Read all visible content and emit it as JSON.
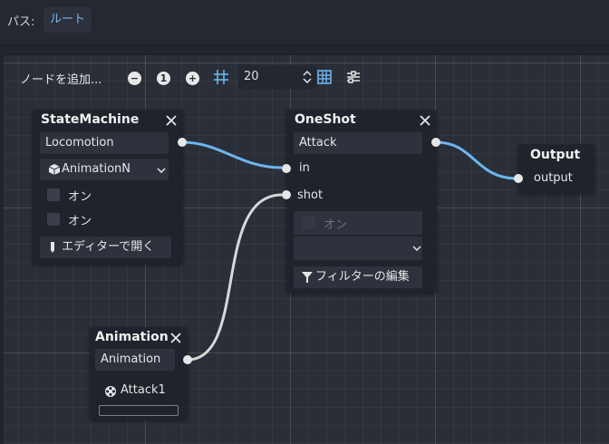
{
  "path": {
    "label": "パス:",
    "root": "ルート"
  },
  "toolbar": {
    "add_node": "ノードを追加...",
    "zoom_out": "−",
    "zoom_reset": "1",
    "zoom_in": "+",
    "snap_value": "20",
    "icons": [
      "zoom-out-icon",
      "zoom-reset-icon",
      "zoom-in-icon",
      "snap-grid-icon",
      "spin-arrows-icon",
      "grid-toggle-icon",
      "minimap-icon"
    ]
  },
  "nodes": {
    "statemachine": {
      "title": "StateMachine",
      "port_label": "Locomotion",
      "animation_select": "AnimationN",
      "toggle1": "オン",
      "toggle2": "オン",
      "open_editor": "エディターで開く"
    },
    "oneshot": {
      "title": "OneShot",
      "out_label": "Attack",
      "in_label": "in",
      "shot_label": "shot",
      "toggle": "オン",
      "filter_button": "フィルターの編集"
    },
    "output": {
      "title": "Output",
      "in_label": "output"
    },
    "animation": {
      "title": "Animation",
      "out_label": "Animation",
      "clip": "Attack1"
    }
  },
  "colors": {
    "accent": "#7ab6f2",
    "wire_blue": "#6cb6f0",
    "wire_white": "#d8d8d8"
  }
}
